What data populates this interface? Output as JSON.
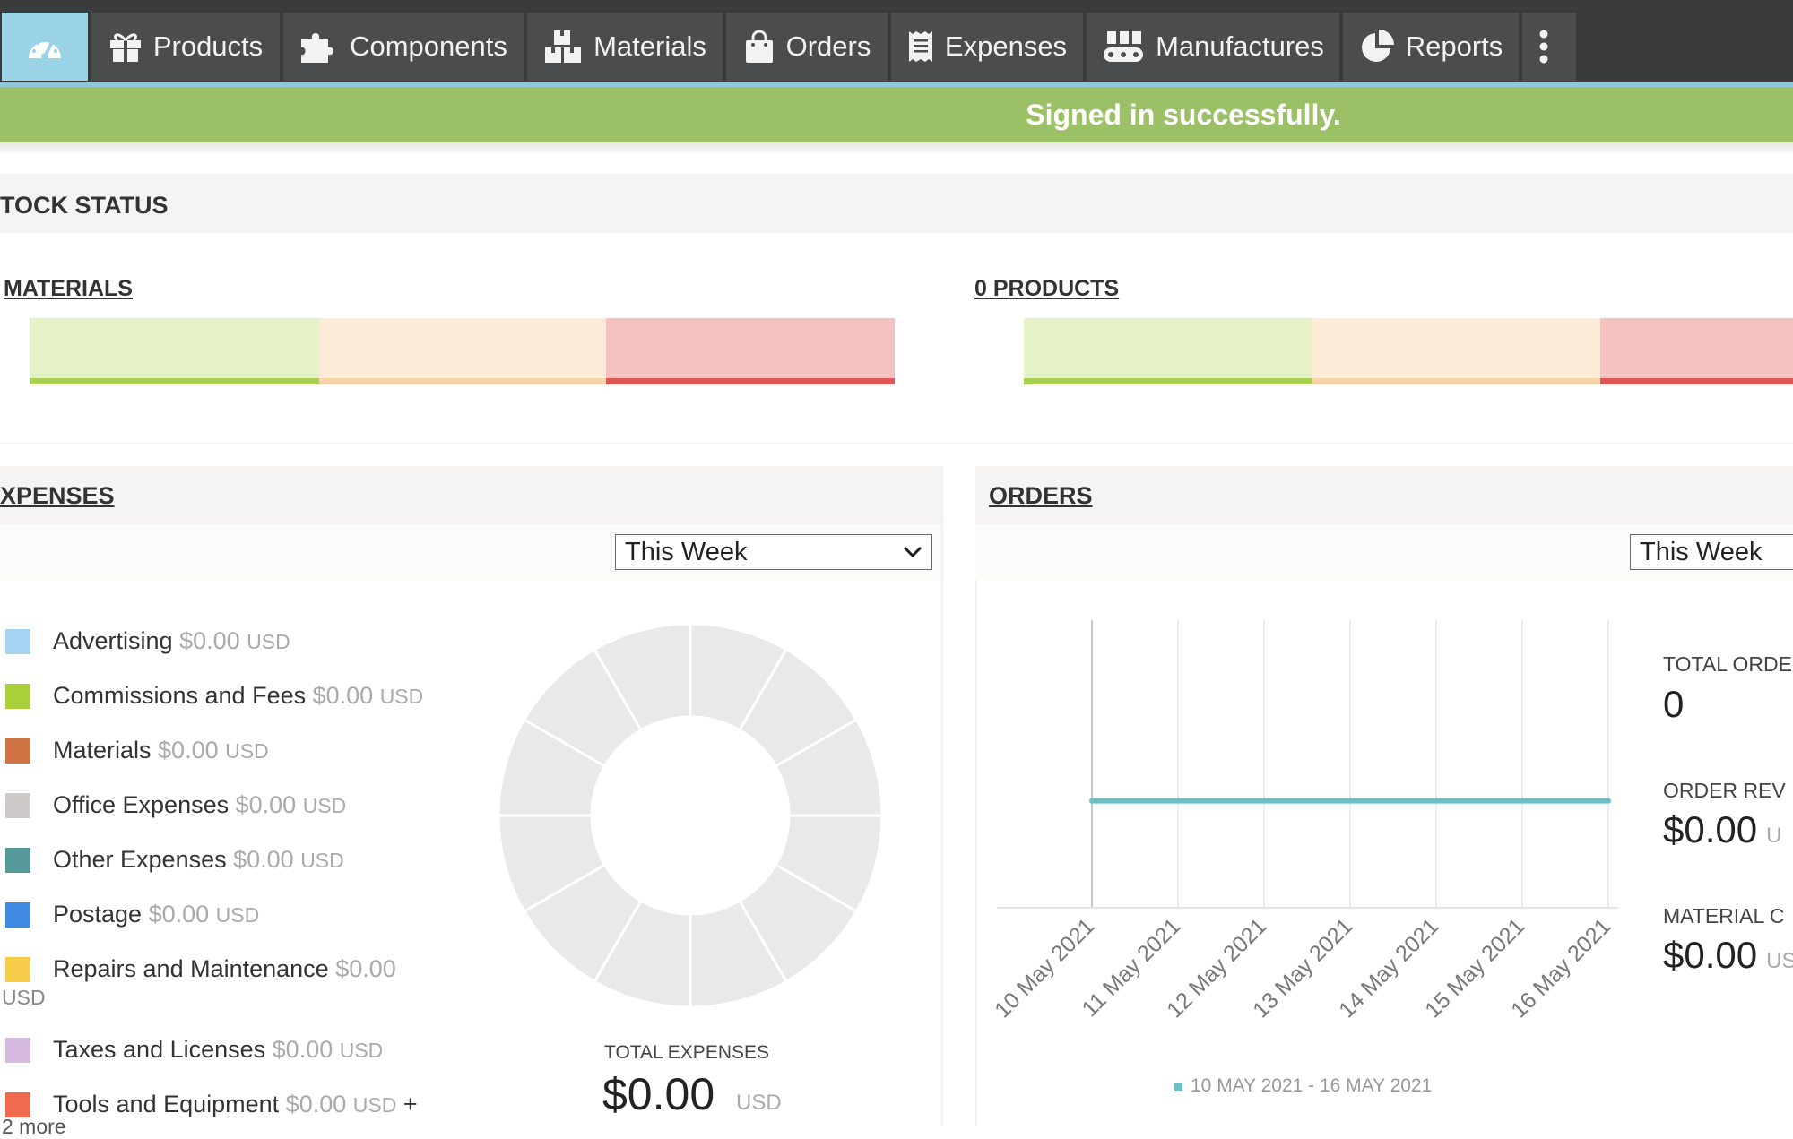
{
  "nav": {
    "items": [
      {
        "label": "",
        "icon": "dashboard-icon"
      },
      {
        "label": "Products",
        "icon": "gift-icon"
      },
      {
        "label": "Components",
        "icon": "puzzle-icon"
      },
      {
        "label": "Materials",
        "icon": "boxes-icon"
      },
      {
        "label": "Orders",
        "icon": "shopping-bag-icon"
      },
      {
        "label": "Expenses",
        "icon": "receipt-icon"
      },
      {
        "label": "Manufactures",
        "icon": "conveyor-icon"
      },
      {
        "label": "Reports",
        "icon": "pie-chart-icon"
      }
    ],
    "more_icon": "vertical-dots-icon"
  },
  "alert": {
    "text": "Signed in successfully."
  },
  "stock": {
    "title": "TOCK STATUS",
    "materials_title": "MATERIALS",
    "products_title": "0 PRODUCTS"
  },
  "expenses": {
    "title": "XPENSES",
    "period": "This Week",
    "items": [
      {
        "name": "Advertising",
        "amount": "$0.00",
        "currency": "USD",
        "color": "#a7d3f2"
      },
      {
        "name": "Commissions and Fees",
        "amount": "$0.00",
        "currency": "USD",
        "color": "#a9cf3a"
      },
      {
        "name": "Materials",
        "amount": "$0.00",
        "currency": "USD",
        "color": "#d07444"
      },
      {
        "name": "Office Expenses",
        "amount": "$0.00",
        "currency": "USD",
        "color": "#cfcaca"
      },
      {
        "name": "Other Expenses",
        "amount": "$0.00",
        "currency": "USD",
        "color": "#56999a"
      },
      {
        "name": "Postage",
        "amount": "$0.00",
        "currency": "USD",
        "color": "#3f8ae0"
      },
      {
        "name": "Repairs and Maintenance",
        "amount": "$0.00",
        "currency": "USD",
        "color": "#f7cc4a"
      },
      {
        "name": "Taxes and Licenses",
        "amount": "$0.00",
        "currency": "USD",
        "color": "#d5b8e0"
      },
      {
        "name": "Tools and Equipment",
        "amount": "$0.00",
        "currency": "USD",
        "color": "#ef6a4e",
        "suffix": "+"
      }
    ],
    "overflow_text": "2 more",
    "total_label": "TOTAL EXPENSES",
    "total_value": "$0.00",
    "total_currency": "USD"
  },
  "orders": {
    "title": "ORDERS",
    "period": "This Week",
    "stats": [
      {
        "label": "TOTAL ORDE",
        "value": "0",
        "unit": ""
      },
      {
        "label": "ORDER REV",
        "value": "$0.00",
        "unit": "U"
      },
      {
        "label": "MATERIAL C",
        "value": "$0.00",
        "unit": "US"
      }
    ]
  },
  "chart_data": [
    {
      "type": "pie",
      "categories": [
        "Advertising",
        "Commissions and Fees",
        "Materials",
        "Office Expenses",
        "Other Expenses",
        "Postage",
        "Repairs and Maintenance",
        "Taxes and Licenses",
        "Tools and Equipment",
        "",
        "",
        ""
      ],
      "values": [
        1,
        1,
        1,
        1,
        1,
        1,
        1,
        1,
        1,
        1,
        1,
        1
      ],
      "colors": "#e9e9e9",
      "title": "",
      "xlabel": "",
      "ylabel": ""
    },
    {
      "type": "line",
      "categories": [
        "10 May 2021",
        "11 May 2021",
        "12 May 2021",
        "13 May 2021",
        "14 May 2021",
        "15 May 2021",
        "16 May 2021"
      ],
      "series": [
        {
          "name": "10 MAY 2021 - 16 MAY 2021",
          "values": [
            0,
            0,
            0,
            0,
            0,
            0,
            0
          ],
          "color": "#6cbfc4"
        }
      ],
      "title": "",
      "xlabel": "",
      "ylabel": "",
      "grid": true,
      "legend": "bottom"
    }
  ]
}
